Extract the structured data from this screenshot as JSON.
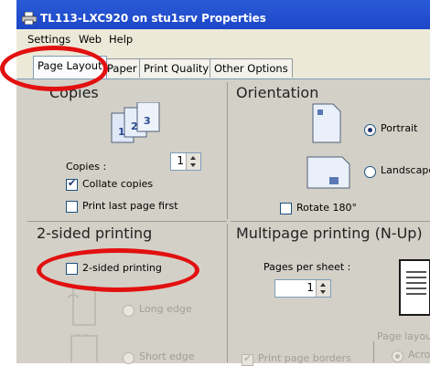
{
  "window": {
    "title": "TL113-LXC920 on stu1srv Properties"
  },
  "menu": {
    "items": [
      {
        "label": "Settings"
      },
      {
        "label": "Web"
      },
      {
        "label": "Help"
      }
    ]
  },
  "tabs": [
    {
      "label": "Page Layout",
      "active": true
    },
    {
      "label": "Paper"
    },
    {
      "label": "Print Quality"
    },
    {
      "label": "Other Options"
    }
  ],
  "copies": {
    "title": "Copies",
    "label": "Copies :",
    "value": "1",
    "collate_label": "Collate copies",
    "collate_checked": true,
    "last_first_label": "Print last page first",
    "last_first_checked": false
  },
  "orientation": {
    "title": "Orientation",
    "portrait_label": "Portrait",
    "portrait_selected": true,
    "landscape_label": "Landscape",
    "rotate_label": "Rotate 180°",
    "rotate_checked": false
  },
  "two_sided": {
    "title": "2-sided printing",
    "checkbox_label": "2-sided printing",
    "checked": false,
    "long_edge_label": "Long edge",
    "short_edge_label": "Short edge"
  },
  "multipage": {
    "title": "Multipage printing (N-Up)",
    "pages_per_sheet_label": "Pages per sheet :",
    "pages_per_sheet_value": "1",
    "print_borders_label": "Print page borders",
    "print_borders_checked": true,
    "page_layout_label": "Page layou",
    "across_label": "Acro"
  },
  "colors": {
    "title_bar": "#1c46c8",
    "panel": "#d3d0c7",
    "annotation": "#e21010"
  }
}
